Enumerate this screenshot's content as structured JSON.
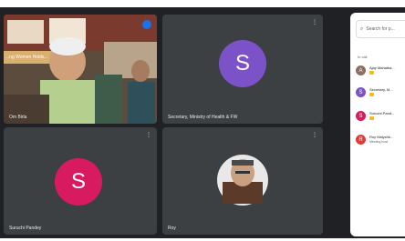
{
  "tiles": [
    {
      "name": "Om Birla",
      "kind": "video"
    },
    {
      "name": "Secretary, Ministry of Health & FW",
      "avatar_letter": "S",
      "avatar_color": "#7b52c7"
    },
    {
      "name": "Suruchi Pandey",
      "avatar_letter": "S",
      "avatar_color": "#d81b60"
    },
    {
      "name": "Roy",
      "kind": "video"
    }
  ],
  "banner_text": "...ng Women Holds...",
  "people_panel": {
    "search_placeholder": "Search for p...",
    "in_call_label": "In call",
    "participants": [
      {
        "name": "Ajay Mahatka...",
        "letter": "A",
        "color": "#8d6e63",
        "sub": ""
      },
      {
        "name": "Secretary, M...",
        "letter": "S",
        "color": "#7b52c7",
        "sub": ""
      },
      {
        "name": "Suruchi Pand...",
        "letter": "S",
        "color": "#d81b60",
        "sub": ""
      },
      {
        "name": "Roy Malyshk...",
        "letter": "R",
        "color": "#e53935",
        "sub": "Meeting host"
      }
    ]
  },
  "colors": {
    "background": "#202124",
    "tile": "#3c4043",
    "panel": "#ffffff"
  }
}
